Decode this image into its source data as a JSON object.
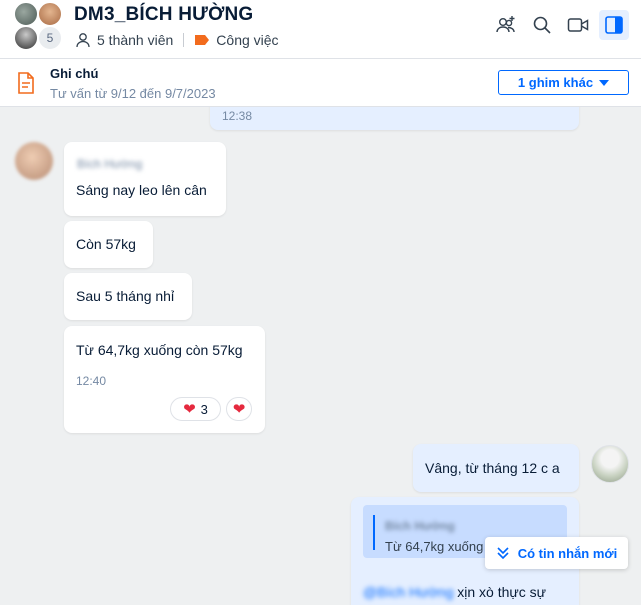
{
  "header": {
    "title": "DM3_BÍCH HƯỜNG",
    "member_count_badge": "5",
    "members": "5 thành viên",
    "label": "Công việc",
    "label_color": "#f26b1d",
    "icons": [
      "add-member-icon",
      "search-icon",
      "video-call-icon",
      "sidebar-toggle-icon"
    ]
  },
  "pinbar": {
    "title": "Ghi chú",
    "subtitle": "Tư vấn từ 9/12 đến 9/7/2023",
    "more_label": "1 ghim khác"
  },
  "messages": {
    "top_time": "12:38",
    "sender": "Bích Hường",
    "m1": "Sáng nay leo lên cân",
    "m2": "Còn 57kg",
    "m3": "Sau 5 tháng nhỉ",
    "m4": "Từ 64,7kg xuống còn 57kg",
    "m4_time": "12:40",
    "m4_reaction_count": "3",
    "reply1": "Vâng, từ tháng 12 c a",
    "quote_sender": "Bích Hường",
    "quote_text": "Từ 64,7kg xuống",
    "mention": "@Bích Hường",
    "reply2_tail": "xịn xò thực sự"
  },
  "new_messages_label": "Có tin nhắn mới",
  "colors": {
    "accent": "#0068ff",
    "my_bubble": "#e5efff",
    "heart": "#e5293e"
  }
}
